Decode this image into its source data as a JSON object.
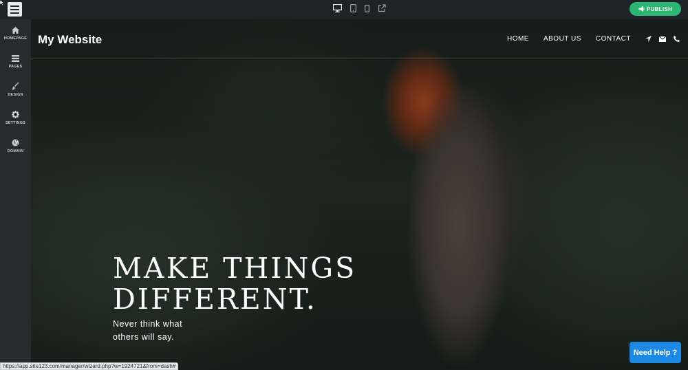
{
  "topbar": {
    "devices": [
      {
        "name": "desktop-icon"
      },
      {
        "name": "tablet-icon"
      },
      {
        "name": "mobile-icon"
      },
      {
        "name": "external-link-icon"
      }
    ],
    "publish_label": "PUBLISH",
    "publish_color": "#2bb673"
  },
  "sidebar": {
    "items": [
      {
        "label": "HOMEPAGE",
        "icon": "home-icon"
      },
      {
        "label": "PAGES",
        "icon": "pages-icon"
      },
      {
        "label": "DESIGN",
        "icon": "brush-icon"
      },
      {
        "label": "SETTINGS",
        "icon": "gear-icon"
      },
      {
        "label": "DOMAIN",
        "icon": "globe-icon"
      }
    ]
  },
  "site": {
    "title": "My Website",
    "nav": [
      "HOME",
      "ABOUT US",
      "CONTACT"
    ],
    "nav_icons": [
      "location-arrow-icon",
      "envelope-icon",
      "phone-icon"
    ],
    "headline_line1": "MAKE THINGS",
    "headline_line2": "DIFFERENT.",
    "subline": "Never think what others will say."
  },
  "help_label": "Need Help ?",
  "help_color": "#1e88e5",
  "status_url": "https://app.site123.com/manager/wizard.php?w=1924721&from=dash#"
}
